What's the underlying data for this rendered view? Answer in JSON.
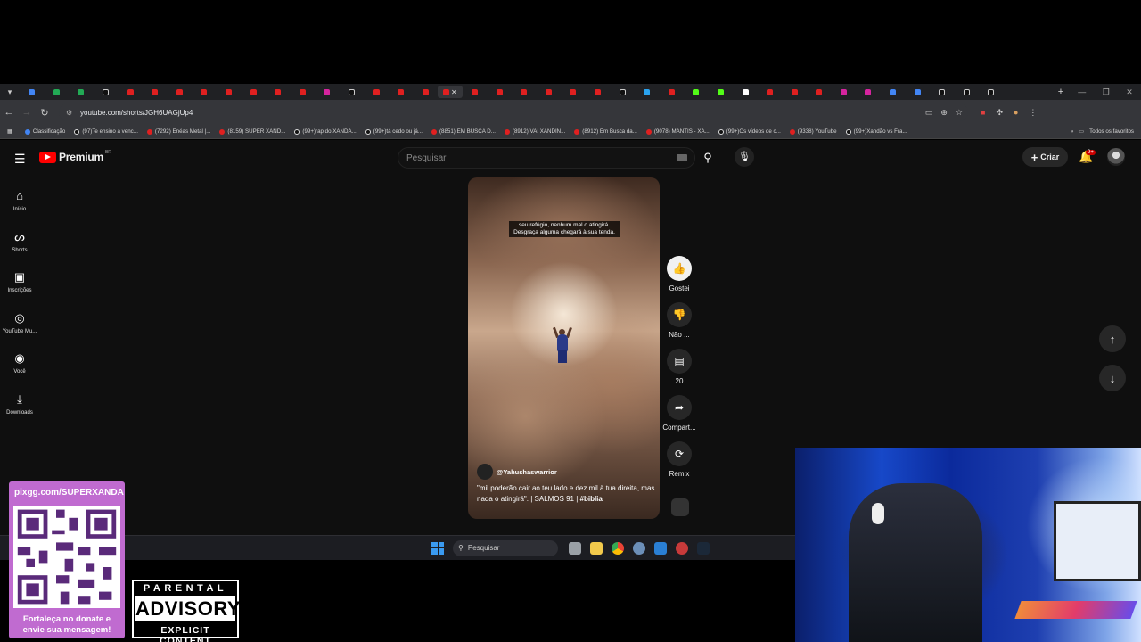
{
  "browser": {
    "tab_count": 40,
    "active_tab_index": 17,
    "tab_favicon_colors": [
      "#4285f4",
      "#22aa55",
      "#22aa55",
      "#111111",
      "#e02020",
      "#e02020",
      "#e02020",
      "#e02020",
      "#e02020",
      "#e02020",
      "#e02020",
      "#e02020",
      "#d6249f",
      "#111111",
      "#e02020",
      "#e02020",
      "#e02020",
      "#e02020",
      "#e02020",
      "#e02020",
      "#e02020",
      "#e02020",
      "#e02020",
      "#e02020",
      "#111111",
      "#2aa3ef",
      "#e02020",
      "#53fc18",
      "#53fc18",
      "#ffffff",
      "#e02020",
      "#e02020",
      "#e02020",
      "#d6249f",
      "#d6249f",
      "#4285f4",
      "#4285f4",
      "#111111",
      "#111111",
      "#111111"
    ],
    "url": "youtube.com/shorts/JGH6UAGjUp4",
    "bookmarks": [
      {
        "label": "Classificação",
        "icon": "google"
      },
      {
        "label": "(97)Te ensino a venc...",
        "icon": "tiktok"
      },
      {
        "label": "(7292) Enéas Metal |...",
        "icon": "youtube"
      },
      {
        "label": "(8159) SUPER XAND...",
        "icon": "youtube"
      },
      {
        "label": "(99+)rap do XANDÃ...",
        "icon": "tiktok"
      },
      {
        "label": "(99+)tá cedo ou já...",
        "icon": "tiktok"
      },
      {
        "label": "(8851) EM BUSCA D...",
        "icon": "youtube"
      },
      {
        "label": "(8912) VAI XANDIN...",
        "icon": "youtube"
      },
      {
        "label": "(8912) Em Busca da...",
        "icon": "youtube"
      },
      {
        "label": "(9078) MANTIS - XA...",
        "icon": "youtube"
      },
      {
        "label": "(99+)Os vídeos de c...",
        "icon": "tiktok"
      },
      {
        "label": "(9338) YouTube",
        "icon": "youtube"
      },
      {
        "label": "(99+)Xandão vs Fra...",
        "icon": "tiktok"
      }
    ],
    "all_bookmarks_label": "Todos os favoritos"
  },
  "youtube": {
    "logo_text": "Premium",
    "country_code": "BR",
    "search_placeholder": "Pesquisar",
    "create_label": "Criar",
    "notification_badge": "9+",
    "guide": [
      {
        "label": "Início",
        "icon": "home-icon",
        "glyph": "⌂"
      },
      {
        "label": "Shorts",
        "icon": "shorts-icon",
        "glyph": "ᔕ"
      },
      {
        "label": "Inscrições",
        "icon": "subscriptions-icon",
        "glyph": "▣"
      },
      {
        "label": "YouTube Mu...",
        "icon": "youtube-music-icon",
        "glyph": "◎"
      },
      {
        "label": "Você",
        "icon": "user-icon",
        "glyph": "◉"
      },
      {
        "label": "Downloads",
        "icon": "download-icon",
        "glyph": "⤓"
      }
    ],
    "short": {
      "caption_line1": "seu refúgio, nenhum mal o atingirá.",
      "caption_line2": "Desgraça alguma chegará à sua tenda.",
      "channel": "@Yahushaswarrior",
      "description": "\"mil poderão cair ao teu lado e dez mil à tua direita, mas nada o atingirá\". | SALMOS 91 |",
      "hashtag": "#biblia"
    },
    "actions": [
      {
        "label": "Gostei",
        "icon": "like-icon",
        "glyph": "👍",
        "active": true
      },
      {
        "label": "Não ...",
        "icon": "dislike-icon",
        "glyph": "👎",
        "active": false
      },
      {
        "label": "20",
        "icon": "comment-icon",
        "glyph": "▤",
        "active": false
      },
      {
        "label": "Compart...",
        "icon": "share-icon",
        "glyph": "➦",
        "active": false
      },
      {
        "label": "Remix",
        "icon": "remix-icon",
        "glyph": "⟳",
        "active": false
      }
    ]
  },
  "taskbar": {
    "search_placeholder": "Pesquisar"
  },
  "overlay": {
    "donate_url": "pixgg.com/SUPERXANDA",
    "donate_message": "Fortaleça no donate e envie sua mensagem!",
    "parental_line1": "PARENTAL",
    "parental_line2": "ADVISORY",
    "parental_line3": "EXPLICIT CONTENT"
  },
  "colors": {
    "brand_red": "#ff0000",
    "yt_background": "#0f0f0f",
    "donate_purple": "#c06bd0",
    "taskbar": "#1c1d22"
  }
}
